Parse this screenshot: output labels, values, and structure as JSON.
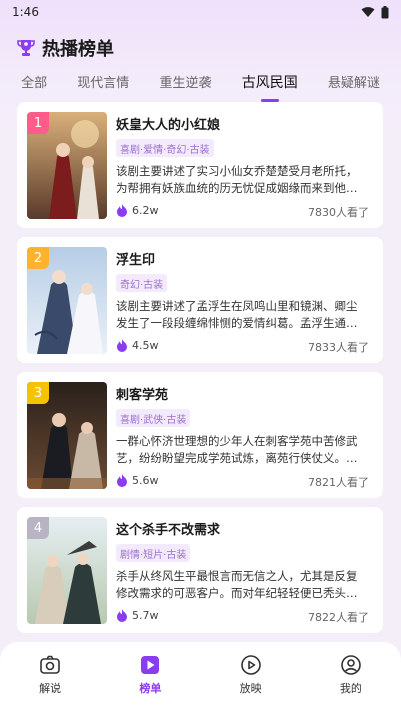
{
  "status_bar": {
    "time": "1:46"
  },
  "page": {
    "title": "热播榜单"
  },
  "tabs": [
    {
      "label": "全部"
    },
    {
      "label": "现代言情"
    },
    {
      "label": "重生逆袭"
    },
    {
      "label": "古风民国",
      "active": true
    },
    {
      "label": "悬疑解谜"
    }
  ],
  "items": [
    {
      "rank": "1",
      "rank_color": "#ff5c8a",
      "title": "妖皇大人的小红娘",
      "tags": "喜剧·爱情·奇幻·古装",
      "desc": "该剧主要讲述了实习小仙女乔楚楚受月老所托，为帮拥有妖族血统的历无忧促成姻缘而来到他…",
      "likes": "6.2w",
      "views": "7830人看了"
    },
    {
      "rank": "2",
      "rank_color": "#ffb22e",
      "title": "浮生印",
      "tags": "奇幻·古装",
      "desc": "该剧主要讲述了孟浮生在凤鸣山里和镜渊、卿尘发生了一段段缠绵悱恻的爱情纠葛。孟浮生通…",
      "likes": "4.5w",
      "views": "7833人看了"
    },
    {
      "rank": "3",
      "rank_color": "#f5c400",
      "title": "刺客学苑",
      "tags": "喜剧·武侠·古装",
      "desc": "一群心怀济世理想的少年人在刺客学苑中苦修武艺，纷纷盼望完成学苑试炼，离苑行侠仗义。…",
      "likes": "5.6w",
      "views": "7821人看了"
    },
    {
      "rank": "4",
      "rank_color": "#b9b4c4",
      "title": "这个杀手不改需求",
      "tags": "剧情·短片·古装",
      "desc": "杀手从终风生平最恨言而无信之人，尤其是反复修改需求的可恶客户。而对年纪轻轻便已秃头…",
      "likes": "5.7w",
      "views": "7822人看了"
    }
  ],
  "bottom_nav": [
    {
      "label": "解说",
      "icon": "camera-icon"
    },
    {
      "label": "榜单",
      "icon": "rank-icon",
      "active": true
    },
    {
      "label": "放映",
      "icon": "play-icon"
    },
    {
      "label": "我的",
      "icon": "user-icon"
    }
  ],
  "colors": {
    "accent": "#8a3cf0",
    "tag_bg": "#f3ebfb",
    "tag_text": "#9b6fd0"
  }
}
